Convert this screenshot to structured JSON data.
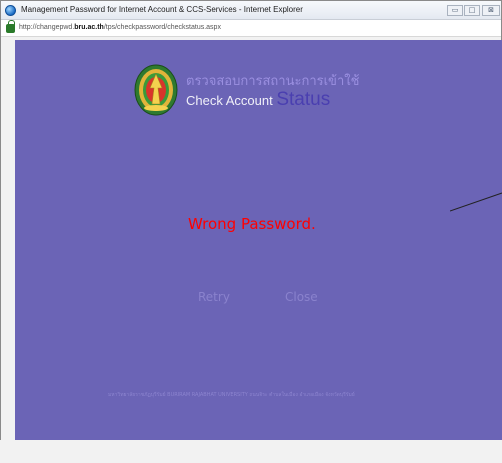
{
  "window": {
    "title": "Management Password for Internet Account & CCS-Services - Internet Explorer",
    "url_prefix": "http://changepwd.",
    "url_host": "bru.ac.th",
    "url_path": "/tps/checkpassword/checkstatus.aspx",
    "min_icon": "minimize-icon",
    "max_icon": "maximize-icon",
    "close_icon": "close-icon"
  },
  "page": {
    "header_thai": "ตรวจสอบการสถานะการเข้าใช้",
    "header_small": "Check Account ",
    "header_big": "Status",
    "message": "Wrong Password.",
    "retry_label": "Retry",
    "close_label": "Close",
    "footer": "มหาวิทยาลัยราชภัฏบุรีรัมย์ BURIRAM RAJABHAT UNIVERSITY ถนนจิระ ตำบลในเมือง อำเภอเมือง จังหวัดบุรีรัมย์"
  },
  "colors": {
    "background": "#6b64b6",
    "message": "#ff0000",
    "header_thai": "#9a8fe0",
    "header_big": "#4a3fb0",
    "link": "#8a82cd"
  }
}
